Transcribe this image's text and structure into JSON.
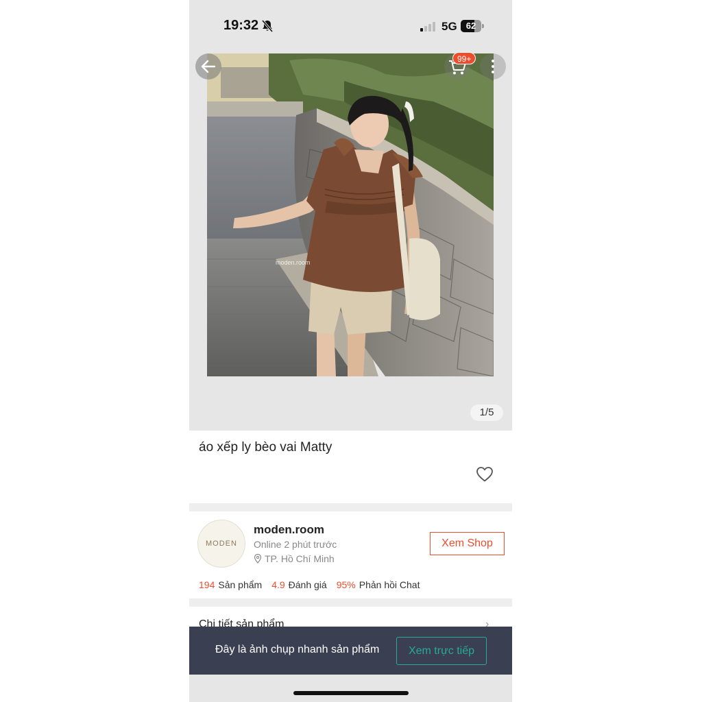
{
  "status_bar": {
    "time": "19:32",
    "network": "5G",
    "battery": "62",
    "bell_icon": "bell-slash-icon"
  },
  "gallery": {
    "counter": "1/5",
    "cart_badge": "99+",
    "watermark": "moden.room"
  },
  "product": {
    "title": "áo xếp ly bèo vai Matty"
  },
  "shop": {
    "logo_text": "MODEN",
    "name": "moden.room",
    "online": "Online 2 phút trước",
    "location": "TP. Hồ Chí Minh",
    "view_button": "Xem Shop",
    "stats": [
      {
        "value": "194",
        "label": "Sản phẩm"
      },
      {
        "value": "4.9",
        "label": "Đánh giá"
      },
      {
        "value": "95%",
        "label": "Phản hồi Chat"
      }
    ]
  },
  "details": {
    "label": "Chi tiết sản phẩm"
  },
  "banner": {
    "text": "Đây là ảnh chụp nhanh sản phẩm",
    "button": "Xem trực tiếp"
  },
  "colors": {
    "accent": "#ee4d2d",
    "teal": "#26aa99",
    "banner_bg": "#3b3f52"
  }
}
